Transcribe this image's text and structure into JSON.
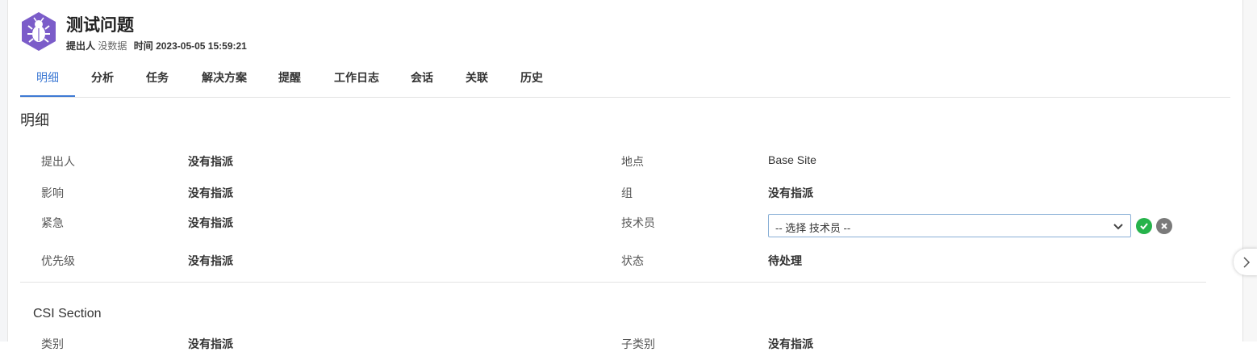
{
  "header": {
    "title": "测试问题",
    "requester_label": "提出人",
    "requester_value": "没数据",
    "time_label": "时间",
    "time_value": "2023-05-05 15:59:21",
    "icon": "bug-icon",
    "icon_color": "#7b5cc9"
  },
  "tabs": [
    {
      "label": "明细",
      "active": true
    },
    {
      "label": "分析"
    },
    {
      "label": "任务"
    },
    {
      "label": "解决方案"
    },
    {
      "label": "提醒"
    },
    {
      "label": "工作日志"
    },
    {
      "label": "会话"
    },
    {
      "label": "关联"
    },
    {
      "label": "历史"
    }
  ],
  "details": {
    "title": "明细",
    "left": [
      {
        "label": "提出人",
        "value": "没有指派"
      },
      {
        "label": "影响",
        "value": "没有指派"
      },
      {
        "label": "紧急",
        "value": "没有指派"
      },
      {
        "label": "优先级",
        "value": "没有指派"
      }
    ],
    "right": [
      {
        "label": "地点",
        "value": "Base Site"
      },
      {
        "label": "组",
        "value": "没有指派"
      },
      {
        "label": "技术员",
        "select_value": "-- 选择 技术员 --"
      },
      {
        "label": "状态",
        "value": "待处理"
      }
    ]
  },
  "csi": {
    "title": "CSI Section",
    "cut_left_label": "类别",
    "cut_left_value": "没有指派",
    "cut_right_label": "子类别",
    "cut_right_value": "没有指派"
  },
  "colors": {
    "accent": "#3e7ad4",
    "confirm": "#26b34b",
    "cancel": "#7a7a7a"
  }
}
